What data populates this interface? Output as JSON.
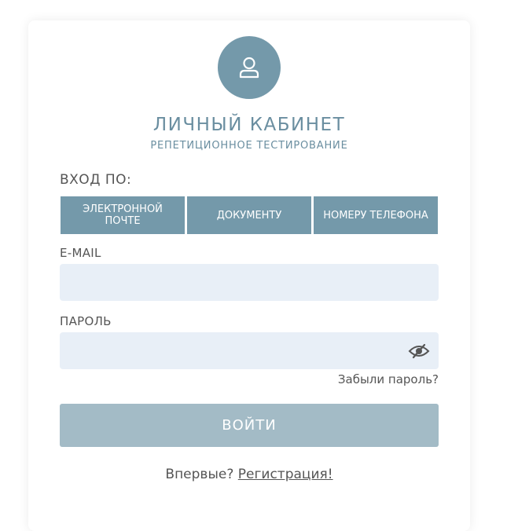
{
  "colors": {
    "accent": "#7499aa",
    "title": "#6a8ea0",
    "field_bg": "#e8eff7",
    "submit_bg": "#a3bbc6",
    "eye_icon": "#555555"
  },
  "header": {
    "avatar_icon": "user-icon",
    "title": "ЛИЧНЫЙ КАБИНЕТ",
    "subtitle": "РЕПЕТИЦИОННОЕ ТЕСТИРОВАНИЕ"
  },
  "login_by": {
    "label": "ВХОД ПО:",
    "methods": [
      {
        "label": "ЭЛЕКТРОННОЙ ПОЧТЕ"
      },
      {
        "label": "ДОКУМЕНТУ"
      },
      {
        "label": "НОМЕРУ ТЕЛЕФОНА"
      }
    ]
  },
  "form": {
    "email": {
      "label": "E-MAIL",
      "value": "",
      "placeholder": ""
    },
    "password": {
      "label": "ПАРОЛЬ",
      "value": "",
      "placeholder": "",
      "toggle_icon": "eye-slash-icon"
    },
    "forgot_label": "Забыли пароль?",
    "submit_label": "ВОЙТИ"
  },
  "footer": {
    "prompt": "Впервые?",
    "register_label": "Регистрация!"
  }
}
